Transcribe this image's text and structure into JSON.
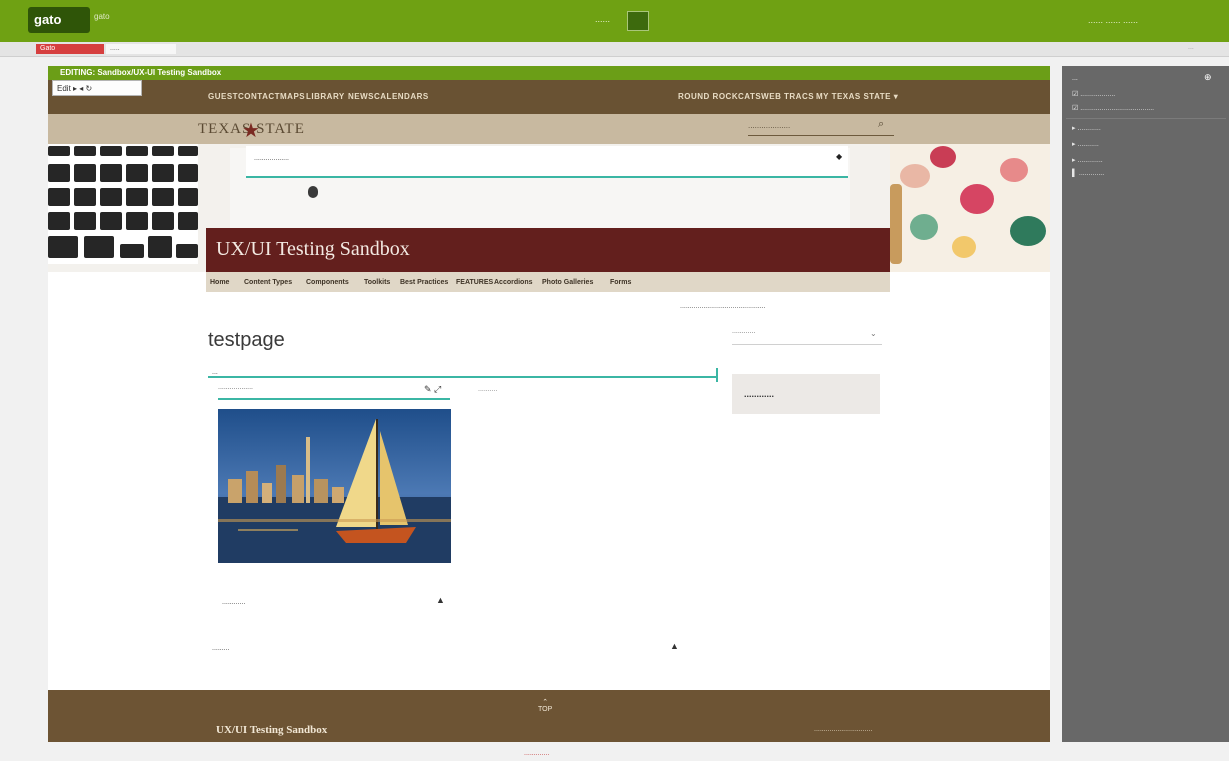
{
  "app": {
    "logo": "gato",
    "logo_sub": "gato",
    "center_text": "......",
    "right_text": "......  ......  ......",
    "browser_tabs": [
      "Gato",
      "....."
    ],
    "tabstrip_right": "..."
  },
  "editor": {
    "bar_label": "EDITING: Sandbox/UX-UI Testing Sandbox",
    "buttons_label": "Edit  ▸  ◂  ↻"
  },
  "utility_nav": {
    "left_items": [
      "GUEST",
      "CONTACT",
      "MAPS",
      "LIBRARY",
      "NEWS",
      "CALENDARS"
    ],
    "right_items": [
      "ROUND ROCK",
      "CATSWEB",
      "TRACS",
      "MY TEXAS STATE ▾"
    ]
  },
  "brand": {
    "logo": "TEXAS STATE",
    "star": "★",
    "search_placeholder": "..................."
  },
  "hero": {
    "field_label": "..................",
    "field_icon": "◆",
    "site_title": "UX/UI Testing Sandbox"
  },
  "main_nav": [
    "Home",
    "Content Types",
    "Components",
    "Toolkits",
    "Best Practices",
    "FEATURES",
    "Accordions",
    "Photo Galleries",
    "Forms"
  ],
  "top_link": "............................................",
  "page": {
    "title": "testpage",
    "field_label": "...",
    "image_field": "..................",
    "image_field_icons": "✎ ⤢",
    "right_field": "..........",
    "accordion1": "............",
    "accordion2": ".........",
    "accordion_icon": "▲"
  },
  "sidebar": {
    "select_text": "............",
    "select_arrow": "⌄",
    "box_label": "............"
  },
  "footer": {
    "top_arrow": "⌃",
    "top_label": "TOP",
    "title": "UX/UI Testing Sandbox",
    "right_text": ".............................."
  },
  "bottom_link": ".............",
  "right_panel": {
    "title": "...",
    "close": "⊕",
    "items": [
      "☑ ..................",
      "☑ ......................................",
      "▸ ............",
      "▸ ...........",
      "▸ .............",
      "▌ ............."
    ]
  },
  "colors": {
    "app_green": "#6fa113",
    "maroon": "#631f1d",
    "brown": "#695233",
    "teal": "#3bb6a4"
  }
}
